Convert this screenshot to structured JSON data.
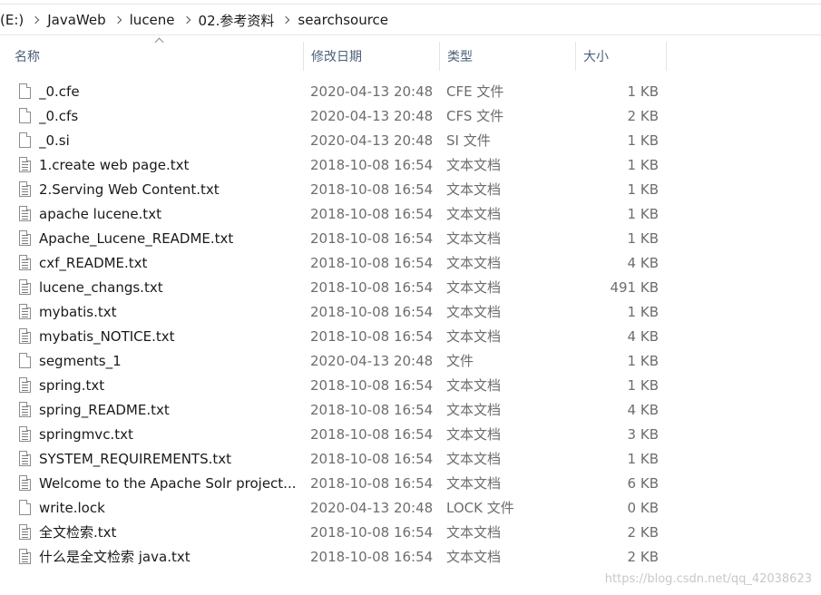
{
  "breadcrumb": [
    "(E:)",
    "JavaWeb",
    "lucene",
    "02.参考资料",
    "searchsource"
  ],
  "columns": {
    "name": "名称",
    "date": "修改日期",
    "type": "类型",
    "size": "大小"
  },
  "files": [
    {
      "name": "_0.cfe",
      "date": "2020-04-13 20:48",
      "type": "CFE 文件",
      "size": "1 KB",
      "icon": "blank-file-icon"
    },
    {
      "name": "_0.cfs",
      "date": "2020-04-13 20:48",
      "type": "CFS 文件",
      "size": "2 KB",
      "icon": "blank-file-icon"
    },
    {
      "name": "_0.si",
      "date": "2020-04-13 20:48",
      "type": "SI 文件",
      "size": "1 KB",
      "icon": "blank-file-icon"
    },
    {
      "name": "1.create web page.txt",
      "date": "2018-10-08 16:54",
      "type": "文本文档",
      "size": "1 KB",
      "icon": "text-file-icon"
    },
    {
      "name": "2.Serving Web Content.txt",
      "date": "2018-10-08 16:54",
      "type": "文本文档",
      "size": "1 KB",
      "icon": "text-file-icon"
    },
    {
      "name": "apache lucene.txt",
      "date": "2018-10-08 16:54",
      "type": "文本文档",
      "size": "1 KB",
      "icon": "text-file-icon"
    },
    {
      "name": "Apache_Lucene_README.txt",
      "date": "2018-10-08 16:54",
      "type": "文本文档",
      "size": "1 KB",
      "icon": "text-file-icon"
    },
    {
      "name": "cxf_README.txt",
      "date": "2018-10-08 16:54",
      "type": "文本文档",
      "size": "4 KB",
      "icon": "text-file-icon"
    },
    {
      "name": "lucene_changs.txt",
      "date": "2018-10-08 16:54",
      "type": "文本文档",
      "size": "491 KB",
      "icon": "text-file-icon"
    },
    {
      "name": "mybatis.txt",
      "date": "2018-10-08 16:54",
      "type": "文本文档",
      "size": "1 KB",
      "icon": "text-file-icon"
    },
    {
      "name": "mybatis_NOTICE.txt",
      "date": "2018-10-08 16:54",
      "type": "文本文档",
      "size": "4 KB",
      "icon": "text-file-icon"
    },
    {
      "name": "segments_1",
      "date": "2020-04-13 20:48",
      "type": "文件",
      "size": "1 KB",
      "icon": "blank-file-icon"
    },
    {
      "name": "spring.txt",
      "date": "2018-10-08 16:54",
      "type": "文本文档",
      "size": "1 KB",
      "icon": "text-file-icon"
    },
    {
      "name": "spring_README.txt",
      "date": "2018-10-08 16:54",
      "type": "文本文档",
      "size": "4 KB",
      "icon": "text-file-icon"
    },
    {
      "name": "springmvc.txt",
      "date": "2018-10-08 16:54",
      "type": "文本文档",
      "size": "3 KB",
      "icon": "text-file-icon"
    },
    {
      "name": "SYSTEM_REQUIREMENTS.txt",
      "date": "2018-10-08 16:54",
      "type": "文本文档",
      "size": "1 KB",
      "icon": "text-file-icon"
    },
    {
      "name": "Welcome to the Apache Solr project....",
      "date": "2018-10-08 16:54",
      "type": "文本文档",
      "size": "6 KB",
      "icon": "text-file-icon"
    },
    {
      "name": "write.lock",
      "date": "2020-04-13 20:48",
      "type": "LOCK 文件",
      "size": "0 KB",
      "icon": "blank-file-icon"
    },
    {
      "name": "全文检索.txt",
      "date": "2018-10-08 16:54",
      "type": "文本文档",
      "size": "2 KB",
      "icon": "text-file-icon"
    },
    {
      "name": "什么是全文检索 java.txt",
      "date": "2018-10-08 16:54",
      "type": "文本文档",
      "size": "2 KB",
      "icon": "text-file-icon"
    }
  ],
  "watermark": "https://blog.csdn.net/qq_42038623"
}
